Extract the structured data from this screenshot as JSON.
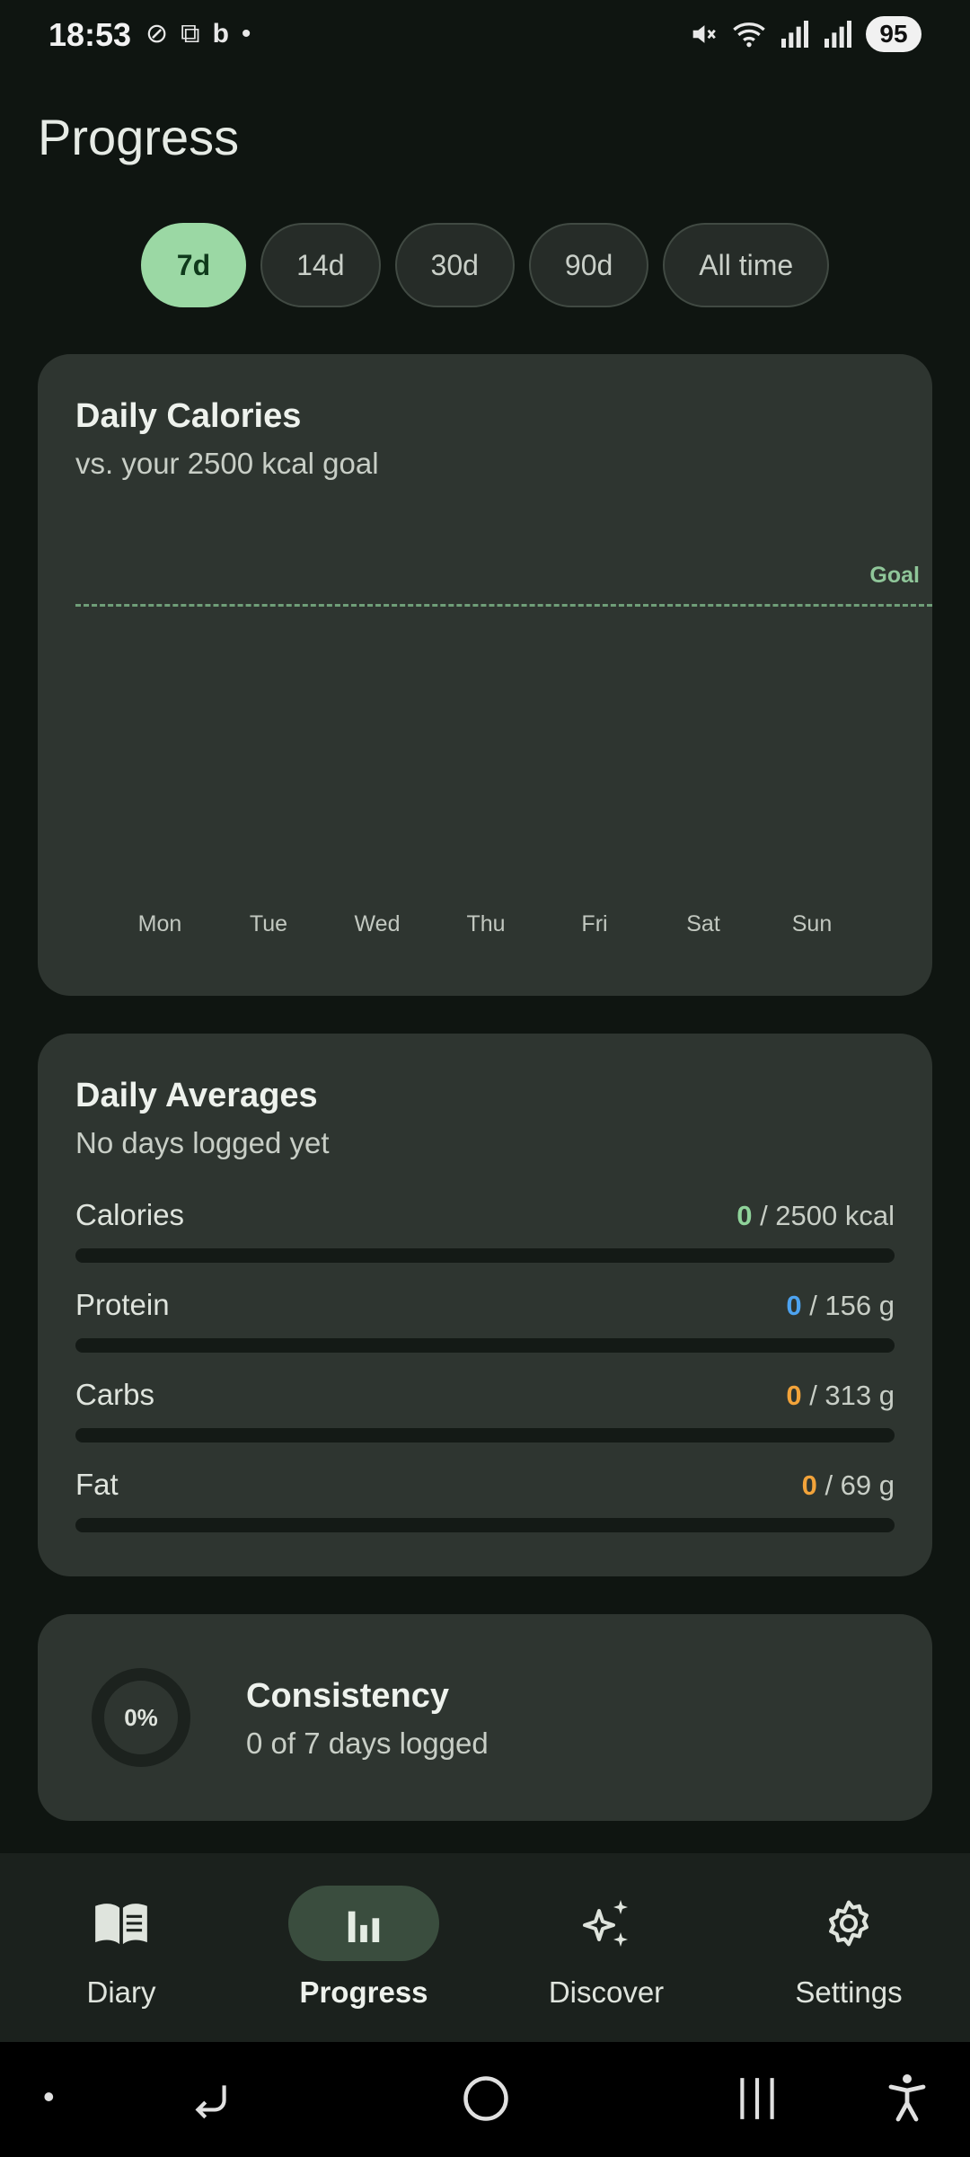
{
  "status_bar": {
    "time": "18:53",
    "left_icons": [
      "do-not-disturb-icon",
      "screenshot-icon",
      "bing-icon",
      "dot-icon"
    ],
    "battery": "95"
  },
  "page": {
    "title": "Progress"
  },
  "ranges": [
    {
      "label": "7d",
      "active": true
    },
    {
      "label": "14d",
      "active": false
    },
    {
      "label": "30d",
      "active": false
    },
    {
      "label": "90d",
      "active": false
    },
    {
      "label": "All time",
      "active": false
    }
  ],
  "calories_card": {
    "title": "Daily Calories",
    "subtitle": "vs. your 2500 kcal goal",
    "goal_label": "Goal"
  },
  "chart_data": {
    "type": "bar",
    "categories": [
      "Mon",
      "Tue",
      "Wed",
      "Thu",
      "Fri",
      "Sat",
      "Sun"
    ],
    "values": [
      0,
      0,
      0,
      0,
      0,
      0,
      0
    ],
    "goal": 2500,
    "title": "Daily Calories",
    "subtitle": "vs. your 2500 kcal goal",
    "goal_label": "Goal",
    "goal_color": "#6f9e78"
  },
  "averages_card": {
    "title": "Daily Averages",
    "subtitle": "No days logged yet",
    "macros": [
      {
        "name": "Calories",
        "value": "0",
        "target": "/ 2500 kcal",
        "color": "#8fd39a",
        "fraction": 0
      },
      {
        "name": "Protein",
        "value": "0",
        "target": "/ 156 g",
        "color": "#4da3f0",
        "fraction": 0
      },
      {
        "name": "Carbs",
        "value": "0",
        "target": "/ 313 g",
        "color": "#f2a33a",
        "fraction": 0
      },
      {
        "name": "Fat",
        "value": "0",
        "target": "/ 69 g",
        "color": "#f2a33a",
        "fraction": 0
      }
    ]
  },
  "consistency_card": {
    "percent": "0%",
    "title": "Consistency",
    "subtitle": "0 of 7 days logged"
  },
  "bottom_nav": [
    {
      "label": "Diary",
      "icon": "book-icon",
      "active": false
    },
    {
      "label": "Progress",
      "icon": "bar-chart-icon",
      "active": true
    },
    {
      "label": "Discover",
      "icon": "sparkles-icon",
      "active": false
    },
    {
      "label": "Settings",
      "icon": "gear-icon",
      "active": false
    }
  ]
}
